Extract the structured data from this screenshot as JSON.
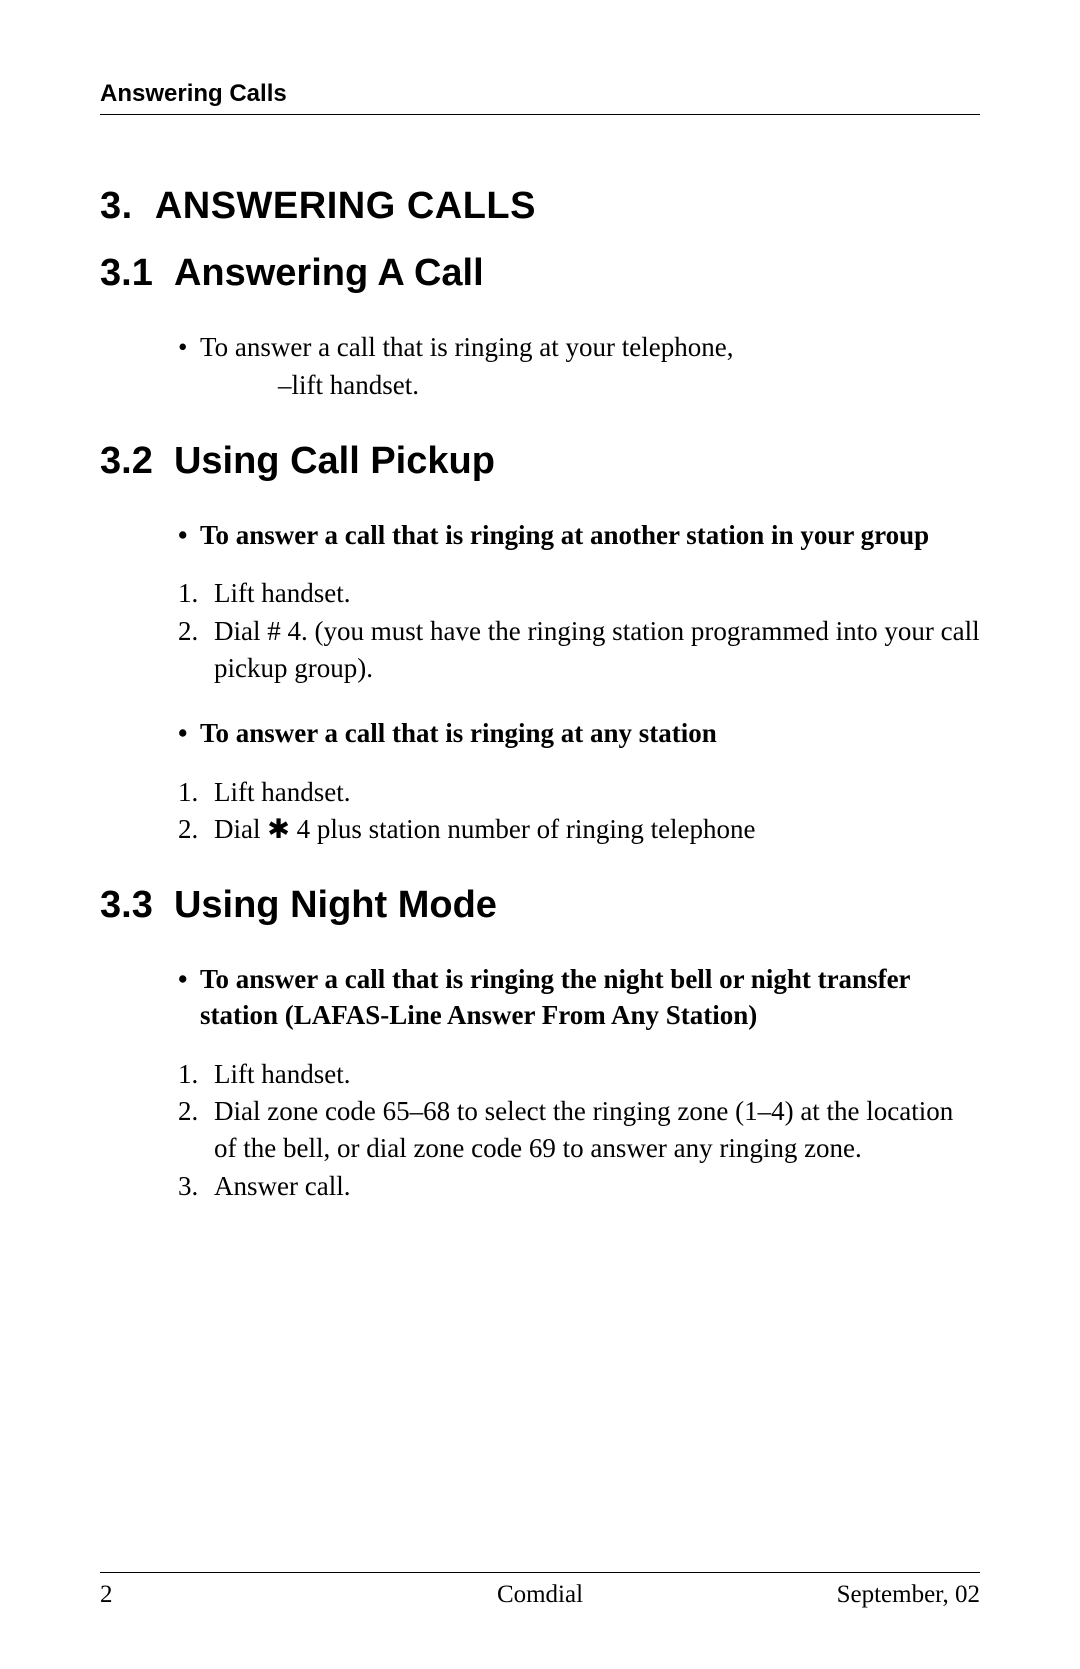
{
  "header": {
    "running_title": "Answering Calls"
  },
  "chapter": {
    "number": "3.",
    "title": "ANSWERING CALLS"
  },
  "sections": {
    "s31": {
      "number": "3.1",
      "title": "Answering A Call",
      "bullet_main": "To answer a call that is ringing at your telephone,",
      "bullet_sub": "–lift handset."
    },
    "s32": {
      "number": "3.2",
      "title": "Using Call Pickup",
      "group_bullet": "To answer a call that is ringing at another station in your group",
      "group_steps": [
        "Lift handset.",
        "Dial # 4. (you must have the ringing station programmed into your call pickup group)."
      ],
      "any_bullet": "To answer a call that is ringing at any station",
      "any_steps": [
        "Lift handset.",
        "Dial ✱ 4 plus station number of ringing telephone"
      ]
    },
    "s33": {
      "number": "3.3",
      "title": "Using Night Mode",
      "bullet": "To answer a call that is ringing the night bell or night transfer station (LAFAS-Line Answer From Any Station)",
      "steps": [
        "Lift handset.",
        "Dial zone code 65–68 to select the ringing zone (1–4) at the location of the bell, or dial zone code 69 to answer any ringing zone.",
        "Answer call."
      ]
    }
  },
  "footer": {
    "page": "2",
    "center": "Comdial",
    "right": "September, 02"
  }
}
